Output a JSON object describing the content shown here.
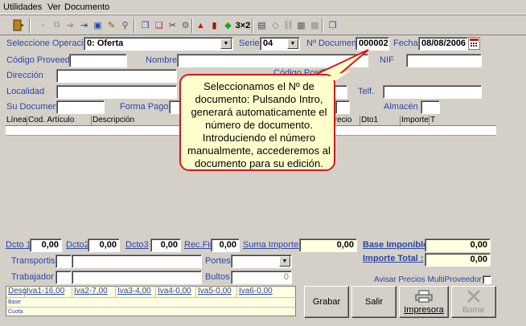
{
  "menu": {
    "items": [
      "Utilidades",
      "Ver",
      "Documento"
    ]
  },
  "toolbar": {
    "button_3x2": "3×2"
  },
  "header": {
    "operacion_label": "Seleccione Operación",
    "operacion_value": "0: Oferta",
    "serie_label": "Serie",
    "serie_value": "04",
    "ndoc_label": "Nº Documento",
    "ndoc_value": "000002",
    "fecha_label": "Fecha",
    "fecha_value": "08/08/2006",
    "proveedor_label": "Código Proveedor",
    "nombre_label": "Nombre",
    "nif_label": "NIF",
    "direccion_label": "Dirección",
    "cpostal_label": "Código Postal",
    "localidad_label": "Localidad",
    "telf_label": "Telf.",
    "sudoc_label": "Su Documento",
    "formapago_label": "Forma Pago",
    "almacen_label": "Almacén"
  },
  "grid": {
    "columns": [
      "Línea",
      "Cod. Artículo",
      "Descripción",
      "Precio",
      "Dto1",
      "Importe",
      "T"
    ]
  },
  "footer": {
    "dcto1_label": "Dcto 1",
    "dcto1_value": "0,00",
    "dcto2_label": "Dcto2",
    "dcto2_value": "0,00",
    "dcto3_label": "Dcto3",
    "dcto3_value": "0,00",
    "recfin_label": "Rec.Fin",
    "recfin_value": "0,00",
    "suma_label": "Suma Importes",
    "suma_value": "0,00",
    "base_label": "Base Imponible",
    "base_value": "0,00",
    "total_label": "Importe Total :",
    "total_value": "0,00",
    "transportista_label": "Transportista",
    "portes_label": "Portes",
    "trabajador_label": "Trabajador",
    "bultos_label": "Bultos",
    "bultos_value": "0",
    "avisar_label": "Avisar Precios MultiProveedor"
  },
  "iva_table": {
    "headers": [
      "Desg",
      "Iva1-16,00",
      "Iva2-7,00",
      "Iva3-4,00",
      "Iva4-0,00",
      "Iva5-0,00",
      "Iva6-0,00"
    ],
    "rows": [
      "Base",
      "Cuota"
    ]
  },
  "actions": {
    "grabar": "Grabar",
    "salir": "Salir",
    "impresora": "Impresora",
    "borrar": "Borrar"
  },
  "callout": {
    "text": "Seleccionamos el Nº de documento: Pulsando Intro, generará automaticamente el número de documento. Introduciendo el número manualmente, accederemos al documento para su edición."
  },
  "colors": {
    "label_blue": "#2b45a8",
    "callout_border": "#d81818",
    "callout_bg": "#ffffcc",
    "field_yellow": "#ffffe1"
  }
}
